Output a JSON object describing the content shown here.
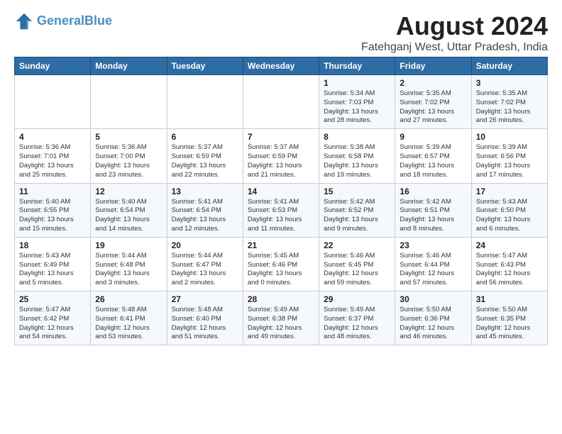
{
  "logo": {
    "line1": "General",
    "line2": "Blue"
  },
  "title": "August 2024",
  "subtitle": "Fatehganj West, Uttar Pradesh, India",
  "days_of_week": [
    "Sunday",
    "Monday",
    "Tuesday",
    "Wednesday",
    "Thursday",
    "Friday",
    "Saturday"
  ],
  "weeks": [
    [
      {
        "day": "",
        "info": ""
      },
      {
        "day": "",
        "info": ""
      },
      {
        "day": "",
        "info": ""
      },
      {
        "day": "",
        "info": ""
      },
      {
        "day": "1",
        "info": "Sunrise: 5:34 AM\nSunset: 7:03 PM\nDaylight: 13 hours\nand 28 minutes."
      },
      {
        "day": "2",
        "info": "Sunrise: 5:35 AM\nSunset: 7:02 PM\nDaylight: 13 hours\nand 27 minutes."
      },
      {
        "day": "3",
        "info": "Sunrise: 5:35 AM\nSunset: 7:02 PM\nDaylight: 13 hours\nand 26 minutes."
      }
    ],
    [
      {
        "day": "4",
        "info": "Sunrise: 5:36 AM\nSunset: 7:01 PM\nDaylight: 13 hours\nand 25 minutes."
      },
      {
        "day": "5",
        "info": "Sunrise: 5:36 AM\nSunset: 7:00 PM\nDaylight: 13 hours\nand 23 minutes."
      },
      {
        "day": "6",
        "info": "Sunrise: 5:37 AM\nSunset: 6:59 PM\nDaylight: 13 hours\nand 22 minutes."
      },
      {
        "day": "7",
        "info": "Sunrise: 5:37 AM\nSunset: 6:59 PM\nDaylight: 13 hours\nand 21 minutes."
      },
      {
        "day": "8",
        "info": "Sunrise: 5:38 AM\nSunset: 6:58 PM\nDaylight: 13 hours\nand 19 minutes."
      },
      {
        "day": "9",
        "info": "Sunrise: 5:39 AM\nSunset: 6:57 PM\nDaylight: 13 hours\nand 18 minutes."
      },
      {
        "day": "10",
        "info": "Sunrise: 5:39 AM\nSunset: 6:56 PM\nDaylight: 13 hours\nand 17 minutes."
      }
    ],
    [
      {
        "day": "11",
        "info": "Sunrise: 5:40 AM\nSunset: 6:55 PM\nDaylight: 13 hours\nand 15 minutes."
      },
      {
        "day": "12",
        "info": "Sunrise: 5:40 AM\nSunset: 6:54 PM\nDaylight: 13 hours\nand 14 minutes."
      },
      {
        "day": "13",
        "info": "Sunrise: 5:41 AM\nSunset: 6:54 PM\nDaylight: 13 hours\nand 12 minutes."
      },
      {
        "day": "14",
        "info": "Sunrise: 5:41 AM\nSunset: 6:53 PM\nDaylight: 13 hours\nand 11 minutes."
      },
      {
        "day": "15",
        "info": "Sunrise: 5:42 AM\nSunset: 6:52 PM\nDaylight: 13 hours\nand 9 minutes."
      },
      {
        "day": "16",
        "info": "Sunrise: 5:42 AM\nSunset: 6:51 PM\nDaylight: 13 hours\nand 8 minutes."
      },
      {
        "day": "17",
        "info": "Sunrise: 5:43 AM\nSunset: 6:50 PM\nDaylight: 13 hours\nand 6 minutes."
      }
    ],
    [
      {
        "day": "18",
        "info": "Sunrise: 5:43 AM\nSunset: 6:49 PM\nDaylight: 13 hours\nand 5 minutes."
      },
      {
        "day": "19",
        "info": "Sunrise: 5:44 AM\nSunset: 6:48 PM\nDaylight: 13 hours\nand 3 minutes."
      },
      {
        "day": "20",
        "info": "Sunrise: 5:44 AM\nSunset: 6:47 PM\nDaylight: 13 hours\nand 2 minutes."
      },
      {
        "day": "21",
        "info": "Sunrise: 5:45 AM\nSunset: 6:46 PM\nDaylight: 13 hours\nand 0 minutes."
      },
      {
        "day": "22",
        "info": "Sunrise: 5:46 AM\nSunset: 6:45 PM\nDaylight: 12 hours\nand 59 minutes."
      },
      {
        "day": "23",
        "info": "Sunrise: 5:46 AM\nSunset: 6:44 PM\nDaylight: 12 hours\nand 57 minutes."
      },
      {
        "day": "24",
        "info": "Sunrise: 5:47 AM\nSunset: 6:43 PM\nDaylight: 12 hours\nand 56 minutes."
      }
    ],
    [
      {
        "day": "25",
        "info": "Sunrise: 5:47 AM\nSunset: 6:42 PM\nDaylight: 12 hours\nand 54 minutes."
      },
      {
        "day": "26",
        "info": "Sunrise: 5:48 AM\nSunset: 6:41 PM\nDaylight: 12 hours\nand 53 minutes."
      },
      {
        "day": "27",
        "info": "Sunrise: 5:48 AM\nSunset: 6:40 PM\nDaylight: 12 hours\nand 51 minutes."
      },
      {
        "day": "28",
        "info": "Sunrise: 5:49 AM\nSunset: 6:38 PM\nDaylight: 12 hours\nand 49 minutes."
      },
      {
        "day": "29",
        "info": "Sunrise: 5:49 AM\nSunset: 6:37 PM\nDaylight: 12 hours\nand 48 minutes."
      },
      {
        "day": "30",
        "info": "Sunrise: 5:50 AM\nSunset: 6:36 PM\nDaylight: 12 hours\nand 46 minutes."
      },
      {
        "day": "31",
        "info": "Sunrise: 5:50 AM\nSunset: 6:35 PM\nDaylight: 12 hours\nand 45 minutes."
      }
    ]
  ]
}
